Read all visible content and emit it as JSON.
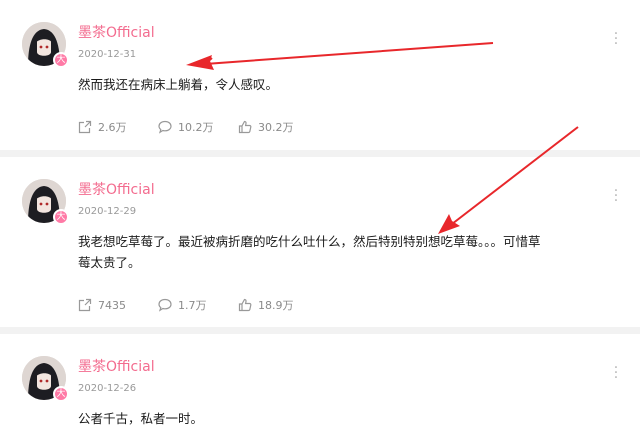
{
  "posts": [
    {
      "username": "墨茶Official",
      "badge": "大",
      "date": "2020-12-31",
      "text": "然而我还在病床上躺着，令人感叹。",
      "share_count": "2.6万",
      "comment_count": "10.2万",
      "like_count": "30.2万"
    },
    {
      "username": "墨茶Official",
      "badge": "大",
      "date": "2020-12-29",
      "text": "我老想吃草莓了。最近被病折磨的吃什么吐什么，然后特别特别想吃草莓。。。可惜草莓太贵了。",
      "share_count": "7435",
      "comment_count": "1.7万",
      "like_count": "18.9万"
    },
    {
      "username": "墨茶Official",
      "badge": "大",
      "date": "2020-12-26",
      "text": "公者千古，私者一时。"
    }
  ],
  "colors": {
    "username": "#f36c8f",
    "arrow": "#e8272b",
    "page_bg": "#f2f2f2",
    "card_bg": "#ffffff"
  },
  "icons": {
    "more": "vertical-ellipsis-icon",
    "share": "share-icon",
    "comment": "comment-icon",
    "like": "thumb-up-icon"
  }
}
